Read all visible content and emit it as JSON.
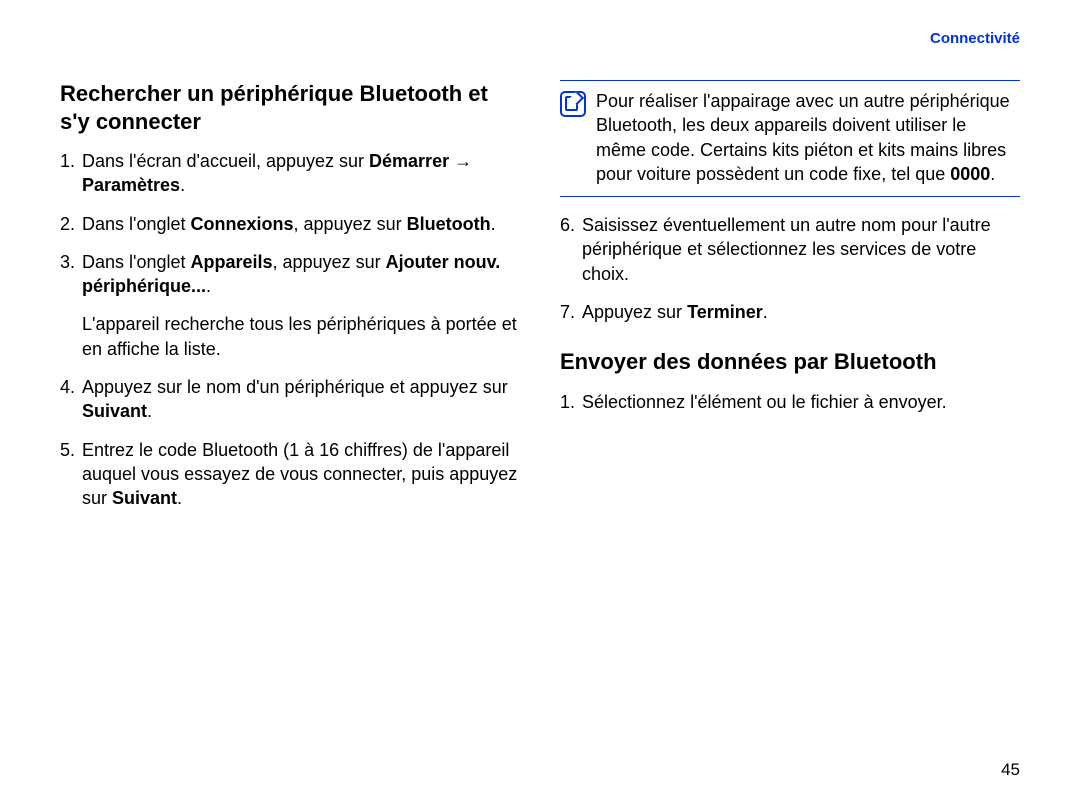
{
  "header": {
    "tag": "Connectivité"
  },
  "left": {
    "heading": "Rechercher un périphérique Bluetooth et s'y connecter",
    "s1_a": "Dans l'écran d'accueil, appuyez sur ",
    "s1_b": "Démarrer → Paramètres",
    "s1_c": ".",
    "s2_a": "Dans l'onglet ",
    "s2_b": "Connexions",
    "s2_c": ", appuyez sur ",
    "s2_d": "Bluetooth",
    "s2_e": ".",
    "s3_a": "Dans l'onglet ",
    "s3_b": "Appareils",
    "s3_c": ", appuyez sur ",
    "s3_d": "Ajouter nouv. périphérique...",
    "s3_e": ".",
    "s3_sub": "L'appareil recherche tous les périphériques à portée et en affiche la liste.",
    "s4_a": "Appuyez sur le nom d'un périphérique et appuyez sur ",
    "s4_b": "Suivant",
    "s4_c": ".",
    "s5_a": "Entrez le code Bluetooth (1 à 16 chiffres) de l'appareil auquel vous essayez de vous connecter, puis appuyez sur ",
    "s5_b": "Suivant",
    "s5_c": "."
  },
  "right": {
    "note_a": "Pour réaliser l'appairage avec un autre périphérique Bluetooth, les deux appareils doivent utiliser le même code. Certains kits piéton et kits mains libres pour voiture possèdent un code fixe, tel que ",
    "note_b": "0000",
    "note_c": ".",
    "s6": "Saisissez éventuellement un autre nom pour l'autre périphérique et sélectionnez les services de votre choix.",
    "s7_a": "Appuyez sur ",
    "s7_b": "Terminer",
    "s7_c": ".",
    "heading2": "Envoyer des données par Bluetooth",
    "b1": "Sélectionnez l'élément ou le fichier à envoyer."
  },
  "page_number": "45"
}
